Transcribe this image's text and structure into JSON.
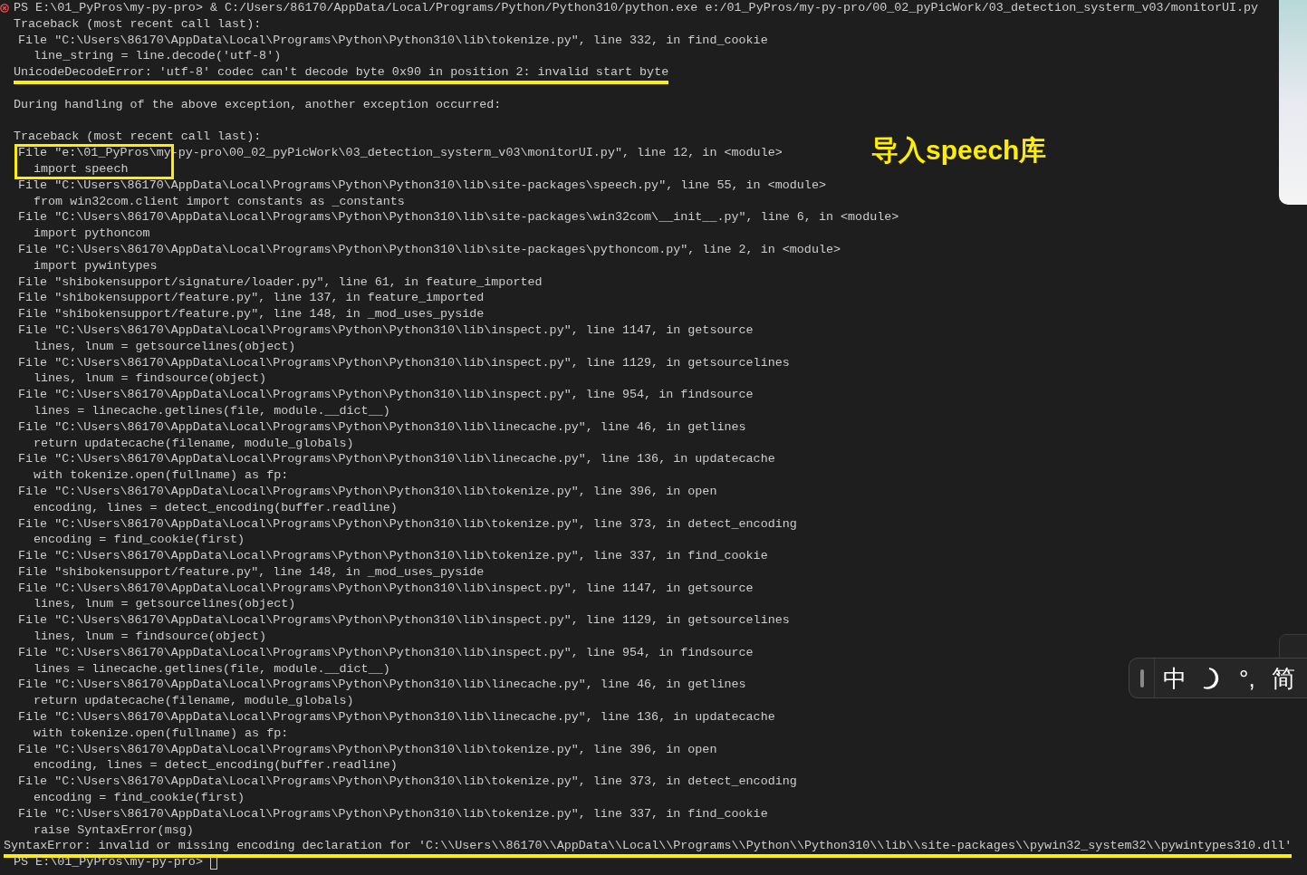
{
  "terminal": {
    "lines": [
      {
        "kind": "prompt",
        "failed": true,
        "cursor": false,
        "text": "PS E:\\01_PyPros\\my-py-pro> & C:/Users/86170/AppData/Local/Programs/Python/Python310/python.exe e:/01_PyPros/my-py-pro/00_02_pyPicWork/03_detection_systerm_v03/monitorUI.py"
      },
      {
        "kind": "head",
        "text": "Traceback (most recent call last):"
      },
      {
        "kind": "frame",
        "text": "File \"C:\\Users\\86170\\AppData\\Local\\Programs\\Python\\Python310\\lib\\tokenize.py\", line 332, in find_cookie"
      },
      {
        "kind": "code",
        "text": "line_string = line.decode('utf-8')"
      },
      {
        "kind": "error",
        "underlined": true,
        "text": "UnicodeDecodeError: 'utf-8' codec can't decode byte 0x90 in position 2: invalid start byte"
      },
      {
        "kind": "blank"
      },
      {
        "kind": "head",
        "text": "During handling of the above exception, another exception occurred:"
      },
      {
        "kind": "blank"
      },
      {
        "kind": "head",
        "text": "Traceback (most recent call last):"
      },
      {
        "kind": "frame",
        "text": "File \"e:\\01_PyPros\\my-py-pro\\00_02_pyPicWork\\03_detection_systerm_v03\\monitorUI.py\", line 12, in <module>"
      },
      {
        "kind": "code",
        "text": "import speech"
      },
      {
        "kind": "frame",
        "text": "File \"C:\\Users\\86170\\AppData\\Local\\Programs\\Python\\Python310\\lib\\site-packages\\speech.py\", line 55, in <module>"
      },
      {
        "kind": "code",
        "text": "from win32com.client import constants as _constants"
      },
      {
        "kind": "frame",
        "text": "File \"C:\\Users\\86170\\AppData\\Local\\Programs\\Python\\Python310\\lib\\site-packages\\win32com\\__init__.py\", line 6, in <module>"
      },
      {
        "kind": "code",
        "text": "import pythoncom"
      },
      {
        "kind": "frame",
        "text": "File \"C:\\Users\\86170\\AppData\\Local\\Programs\\Python\\Python310\\lib\\site-packages\\pythoncom.py\", line 2, in <module>"
      },
      {
        "kind": "code",
        "text": "import pywintypes"
      },
      {
        "kind": "frame",
        "text": "File \"shibokensupport/signature/loader.py\", line 61, in feature_imported"
      },
      {
        "kind": "frame",
        "text": "File \"shibokensupport/feature.py\", line 137, in feature_imported"
      },
      {
        "kind": "frame",
        "text": "File \"shibokensupport/feature.py\", line 148, in _mod_uses_pyside"
      },
      {
        "kind": "frame",
        "text": "File \"C:\\Users\\86170\\AppData\\Local\\Programs\\Python\\Python310\\lib\\inspect.py\", line 1147, in getsource"
      },
      {
        "kind": "code",
        "text": "lines, lnum = getsourcelines(object)"
      },
      {
        "kind": "frame",
        "text": "File \"C:\\Users\\86170\\AppData\\Local\\Programs\\Python\\Python310\\lib\\inspect.py\", line 1129, in getsourcelines"
      },
      {
        "kind": "code",
        "text": "lines, lnum = findsource(object)"
      },
      {
        "kind": "frame",
        "text": "File \"C:\\Users\\86170\\AppData\\Local\\Programs\\Python\\Python310\\lib\\inspect.py\", line 954, in findsource"
      },
      {
        "kind": "code",
        "text": "lines = linecache.getlines(file, module.__dict__)"
      },
      {
        "kind": "frame",
        "text": "File \"C:\\Users\\86170\\AppData\\Local\\Programs\\Python\\Python310\\lib\\linecache.py\", line 46, in getlines"
      },
      {
        "kind": "code",
        "text": "return updatecache(filename, module_globals)"
      },
      {
        "kind": "frame",
        "text": "File \"C:\\Users\\86170\\AppData\\Local\\Programs\\Python\\Python310\\lib\\linecache.py\", line 136, in updatecache"
      },
      {
        "kind": "code",
        "text": "with tokenize.open(fullname) as fp:"
      },
      {
        "kind": "frame",
        "text": "File \"C:\\Users\\86170\\AppData\\Local\\Programs\\Python\\Python310\\lib\\tokenize.py\", line 396, in open"
      },
      {
        "kind": "code",
        "text": "encoding, lines = detect_encoding(buffer.readline)"
      },
      {
        "kind": "frame",
        "text": "File \"C:\\Users\\86170\\AppData\\Local\\Programs\\Python\\Python310\\lib\\tokenize.py\", line 373, in detect_encoding"
      },
      {
        "kind": "code",
        "text": "encoding = find_cookie(first)"
      },
      {
        "kind": "frame",
        "text": "File \"C:\\Users\\86170\\AppData\\Local\\Programs\\Python\\Python310\\lib\\tokenize.py\", line 337, in find_cookie"
      },
      {
        "kind": "frame",
        "text": "File \"shibokensupport/feature.py\", line 148, in _mod_uses_pyside"
      },
      {
        "kind": "frame",
        "text": "File \"C:\\Users\\86170\\AppData\\Local\\Programs\\Python\\Python310\\lib\\inspect.py\", line 1147, in getsource"
      },
      {
        "kind": "code",
        "text": "lines, lnum = getsourcelines(object)"
      },
      {
        "kind": "frame",
        "text": "File \"C:\\Users\\86170\\AppData\\Local\\Programs\\Python\\Python310\\lib\\inspect.py\", line 1129, in getsourcelines"
      },
      {
        "kind": "code",
        "text": "lines, lnum = findsource(object)"
      },
      {
        "kind": "frame",
        "text": "File \"C:\\Users\\86170\\AppData\\Local\\Programs\\Python\\Python310\\lib\\inspect.py\", line 954, in findsource"
      },
      {
        "kind": "code",
        "text": "lines = linecache.getlines(file, module.__dict__)"
      },
      {
        "kind": "frame",
        "text": "File \"C:\\Users\\86170\\AppData\\Local\\Programs\\Python\\Python310\\lib\\linecache.py\", line 46, in getlines"
      },
      {
        "kind": "code",
        "text": "return updatecache(filename, module_globals)"
      },
      {
        "kind": "frame",
        "text": "File \"C:\\Users\\86170\\AppData\\Local\\Programs\\Python\\Python310\\lib\\linecache.py\", line 136, in updatecache"
      },
      {
        "kind": "code",
        "text": "with tokenize.open(fullname) as fp:"
      },
      {
        "kind": "frame",
        "text": "File \"C:\\Users\\86170\\AppData\\Local\\Programs\\Python\\Python310\\lib\\tokenize.py\", line 396, in open"
      },
      {
        "kind": "code",
        "text": "encoding, lines = detect_encoding(buffer.readline)"
      },
      {
        "kind": "frame",
        "text": "File \"C:\\Users\\86170\\AppData\\Local\\Programs\\Python\\Python310\\lib\\tokenize.py\", line 373, in detect_encoding"
      },
      {
        "kind": "code",
        "text": "encoding = find_cookie(first)"
      },
      {
        "kind": "frame",
        "text": "File \"C:\\Users\\86170\\AppData\\Local\\Programs\\Python\\Python310\\lib\\tokenize.py\", line 337, in find_cookie"
      },
      {
        "kind": "code",
        "text": "raise SyntaxError(msg)"
      },
      {
        "kind": "error",
        "underlined": true,
        "text": "SyntaxError: invalid or missing encoding declaration for 'C:\\\\Users\\\\86170\\\\AppData\\\\Local\\\\Programs\\\\Python\\\\Python310\\\\lib\\\\site-packages\\\\pywin32_system32\\\\pywintypes310.dll'"
      },
      {
        "kind": "prompt",
        "failed": false,
        "cursor": true,
        "text": "PS E:\\01_PyPros\\my-py-pro>"
      }
    ]
  },
  "annotation": {
    "text": "导入speech库"
  },
  "ime_toolbar": {
    "items": [
      {
        "kind": "text",
        "text": "中"
      },
      {
        "kind": "moon"
      },
      {
        "kind": "text",
        "text": "°,"
      },
      {
        "kind": "text",
        "text": "简"
      }
    ]
  }
}
